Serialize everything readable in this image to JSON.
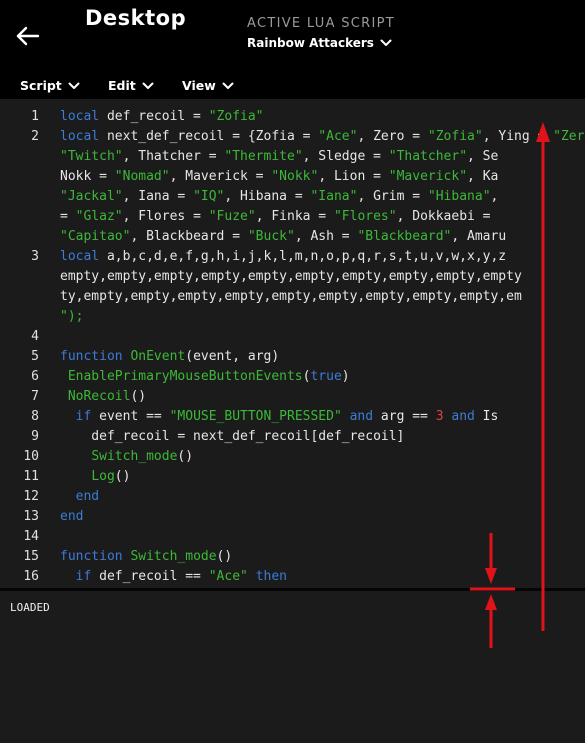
{
  "header": {
    "title": "Desktop",
    "active_label": "ACTIVE LUA SCRIPT",
    "script_name": "Rainbow Attackers"
  },
  "menus": [
    {
      "label": "Script"
    },
    {
      "label": "Edit"
    },
    {
      "label": "View"
    }
  ],
  "icons": {
    "back": "back-arrow-icon",
    "dropdown": "chevron-down-icon"
  },
  "colors": {
    "keyword": "#3d7bd6",
    "string": "#3db838",
    "number": "#e04040",
    "annotation": "#e0121a",
    "header_bg": "#000000",
    "editor_bg": "#1b1b1b"
  },
  "editor": {
    "rows": [
      {
        "num": "1",
        "tokens": [
          {
            "t": "local",
            "c": "kw"
          },
          {
            "t": " def_recoil = "
          },
          {
            "t": "\"Zofia\"",
            "c": "str"
          }
        ]
      },
      {
        "num": "2",
        "tokens": [
          {
            "t": "local",
            "c": "kw"
          },
          {
            "t": " next_def_recoil = {Zofia = "
          },
          {
            "t": "\"Ace\"",
            "c": "str"
          },
          {
            "t": ", Zero = "
          },
          {
            "t": "\"Zofia\"",
            "c": "str"
          },
          {
            "t": ", Ying = "
          },
          {
            "t": "\"Zero\"",
            "c": "str"
          }
        ]
      },
      {
        "num": "",
        "tokens": [
          {
            "t": "\"Twitch\"",
            "c": "str"
          },
          {
            "t": ", Thatcher = "
          },
          {
            "t": "\"Thermite\"",
            "c": "str"
          },
          {
            "t": ", Sledge = "
          },
          {
            "t": "\"Thatcher\"",
            "c": "str"
          },
          {
            "t": ", Se"
          }
        ]
      },
      {
        "num": "",
        "tokens": [
          {
            "t": "Nokk = "
          },
          {
            "t": "\"Nomad\"",
            "c": "str"
          },
          {
            "t": ", Maverick = "
          },
          {
            "t": "\"Nokk\"",
            "c": "str"
          },
          {
            "t": ", Lion = "
          },
          {
            "t": "\"Maverick\"",
            "c": "str"
          },
          {
            "t": ", Ka"
          }
        ]
      },
      {
        "num": "",
        "tokens": [
          {
            "t": "\"Jackal\"",
            "c": "str"
          },
          {
            "t": ", Iana = "
          },
          {
            "t": "\"IQ\"",
            "c": "str"
          },
          {
            "t": ", Hibana = "
          },
          {
            "t": "\"Iana\"",
            "c": "str"
          },
          {
            "t": ", Grim = "
          },
          {
            "t": "\"Hibana\"",
            "c": "str"
          },
          {
            "t": ", "
          }
        ]
      },
      {
        "num": "",
        "tokens": [
          {
            "t": "= "
          },
          {
            "t": "\"Glaz\"",
            "c": "str"
          },
          {
            "t": ", Flores = "
          },
          {
            "t": "\"Fuze\"",
            "c": "str"
          },
          {
            "t": ", Finka = "
          },
          {
            "t": "\"Flores\"",
            "c": "str"
          },
          {
            "t": ", Dokkaebi = "
          }
        ]
      },
      {
        "num": "",
        "tokens": [
          {
            "t": "\"Capitao\"",
            "c": "str"
          },
          {
            "t": ", Blackbeard = "
          },
          {
            "t": "\"Buck\"",
            "c": "str"
          },
          {
            "t": ", Ash = "
          },
          {
            "t": "\"Blackbeard\"",
            "c": "str"
          },
          {
            "t": ", Amaru"
          }
        ]
      },
      {
        "num": "3",
        "tokens": [
          {
            "t": "local",
            "c": "kw"
          },
          {
            "t": " a,b,c,d,e,f,g,h,i,j,k,l,m,n,o,p,q,r,s,t,u,v,w,x,y,z"
          }
        ]
      },
      {
        "num": "",
        "tokens": [
          {
            "t": "empty,empty,empty,empty,empty,empty,empty,empty,empty,empty"
          }
        ]
      },
      {
        "num": "",
        "tokens": [
          {
            "t": "ty,empty,empty,empty,empty,empty,empty,empty,empty,empty,em"
          }
        ]
      },
      {
        "num": "",
        "tokens": [
          {
            "t": "\");",
            "c": "str"
          }
        ]
      },
      {
        "num": "4",
        "tokens": []
      },
      {
        "num": "5",
        "tokens": [
          {
            "t": "function",
            "c": "kw"
          },
          {
            "t": " "
          },
          {
            "t": "OnEvent",
            "c": "fn"
          },
          {
            "t": "(event, arg)"
          }
        ]
      },
      {
        "num": "6",
        "tokens": [
          {
            "t": " "
          },
          {
            "t": "EnablePrimaryMouseButtonEvents",
            "c": "fn"
          },
          {
            "t": "("
          },
          {
            "t": "true",
            "c": "kw"
          },
          {
            "t": ")"
          }
        ]
      },
      {
        "num": "7",
        "tokens": [
          {
            "t": " "
          },
          {
            "t": "NoRecoil",
            "c": "fn"
          },
          {
            "t": "()"
          }
        ]
      },
      {
        "num": "8",
        "tokens": [
          {
            "t": "  "
          },
          {
            "t": "if",
            "c": "kw"
          },
          {
            "t": " event == "
          },
          {
            "t": "\"MOUSE_BUTTON_PRESSED\"",
            "c": "str"
          },
          {
            "t": " "
          },
          {
            "t": "and",
            "c": "kw"
          },
          {
            "t": " arg == "
          },
          {
            "t": "3",
            "c": "num"
          },
          {
            "t": " "
          },
          {
            "t": "and",
            "c": "kw"
          },
          {
            "t": " Is"
          }
        ]
      },
      {
        "num": "9",
        "tokens": [
          {
            "t": "    def_recoil = next_def_recoil[def_recoil]"
          }
        ]
      },
      {
        "num": "10",
        "tokens": [
          {
            "t": "    "
          },
          {
            "t": "Switch_mode",
            "c": "fn"
          },
          {
            "t": "()"
          }
        ]
      },
      {
        "num": "11",
        "tokens": [
          {
            "t": "    "
          },
          {
            "t": "Log",
            "c": "fn"
          },
          {
            "t": "()"
          }
        ]
      },
      {
        "num": "12",
        "tokens": [
          {
            "t": "  "
          },
          {
            "t": "end",
            "c": "kw"
          }
        ]
      },
      {
        "num": "13",
        "tokens": [
          {
            "t": "end",
            "c": "kw"
          }
        ]
      },
      {
        "num": "14",
        "tokens": []
      },
      {
        "num": "15",
        "tokens": [
          {
            "t": "function",
            "c": "kw"
          },
          {
            "t": " "
          },
          {
            "t": "Switch_mode",
            "c": "fn"
          },
          {
            "t": "()"
          }
        ]
      },
      {
        "num": "16",
        "tokens": [
          {
            "t": "  "
          },
          {
            "t": "if",
            "c": "kw"
          },
          {
            "t": " def_recoil == "
          },
          {
            "t": "\"Ace\"",
            "c": "str"
          },
          {
            "t": " "
          },
          {
            "t": "then",
            "c": "kw"
          }
        ]
      }
    ]
  },
  "console": {
    "output": "LOADED"
  }
}
